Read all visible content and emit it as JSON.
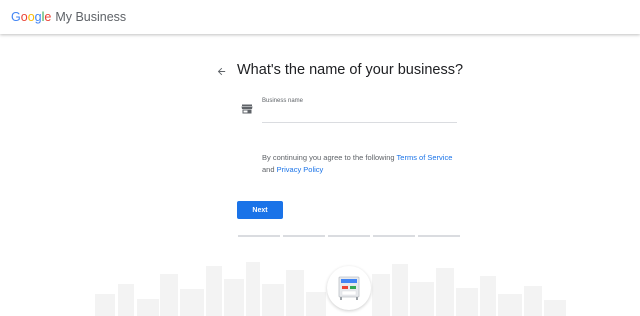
{
  "header": {
    "logo_google": [
      "G",
      "o",
      "o",
      "g",
      "l",
      "e"
    ],
    "logo_product": "My Business"
  },
  "main": {
    "title": "What's the name of your business?",
    "field": {
      "label": "Business name",
      "value": "",
      "icon": "store-icon"
    },
    "terms": {
      "prefix": "By continuing you agree to the following ",
      "terms_link": "Terms of Service",
      "middle": " and ",
      "privacy_link": "Privacy Policy"
    },
    "next_label": "Next",
    "progress_steps": 5,
    "progress_current": 0
  },
  "colors": {
    "accent": "#1a73e8",
    "divider": "#dadce0",
    "skyline": "#f3f3f3"
  }
}
